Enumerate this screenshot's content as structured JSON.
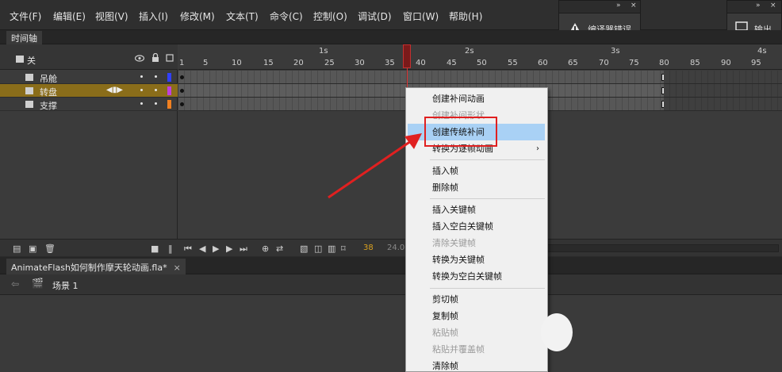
{
  "menubar": {
    "items": [
      "文件(F)",
      "编辑(E)",
      "视图(V)",
      "插入(I)",
      "修改(M)",
      "文本(T)",
      "命令(C)",
      "控制(O)",
      "调试(D)",
      "窗口(W)",
      "帮助(H)"
    ]
  },
  "panels": {
    "compiler_errors": {
      "collapse": "»",
      "close": "×",
      "label": "编译器错误"
    },
    "output": {
      "collapse": "»",
      "close": "×",
      "label": "输出"
    }
  },
  "timeline": {
    "tab_label": "时间轴",
    "header_layer_label": "关",
    "ruler_frames": [
      "1",
      "5",
      "10",
      "15",
      "20",
      "25",
      "30",
      "35",
      "40",
      "45",
      "50",
      "55",
      "60",
      "65",
      "70",
      "75",
      "80",
      "85",
      "90",
      "95"
    ],
    "ruler_seconds": [
      "1s",
      "2s",
      "3s",
      "4s"
    ],
    "layers": [
      {
        "name": "吊舱",
        "color": "#3040ff",
        "selected": false
      },
      {
        "name": "转盘",
        "color": "#c040e0",
        "selected": true
      },
      {
        "name": "支撑",
        "color": "#f08020",
        "selected": false
      }
    ],
    "fps": "38",
    "fps2": "24.00"
  },
  "document": {
    "tab_label": "AnimateFlash如何制作摩天轮动画.fla*",
    "close": "×",
    "scene_label": "场景 1"
  },
  "context_menu": {
    "items": [
      {
        "label": "创建补间动画",
        "disabled": false
      },
      {
        "label": "创建补间形状",
        "disabled": true
      },
      {
        "label": "创建传统补间",
        "disabled": false,
        "highlighted": true
      },
      {
        "label": "转换为逐帧动画",
        "disabled": false,
        "submenu": "›"
      },
      {
        "label": "插入帧",
        "disabled": false
      },
      {
        "label": "删除帧",
        "disabled": false
      },
      {
        "label": "插入关键帧",
        "disabled": false
      },
      {
        "label": "插入空白关键帧",
        "disabled": false
      },
      {
        "label": "清除关键帧",
        "disabled": true
      },
      {
        "label": "转换为关键帧",
        "disabled": false
      },
      {
        "label": "转换为空白关键帧",
        "disabled": false
      },
      {
        "label": "剪切帧",
        "disabled": false
      },
      {
        "label": "复制帧",
        "disabled": false
      },
      {
        "label": "粘贴帧",
        "disabled": true
      },
      {
        "label": "粘贴并覆盖帧",
        "disabled": true
      },
      {
        "label": "清除帧",
        "disabled": false
      }
    ]
  },
  "colors": {
    "annotation": "#e02020",
    "highlight": "#a9d1f5",
    "selected_layer": "#8a6d1a"
  }
}
